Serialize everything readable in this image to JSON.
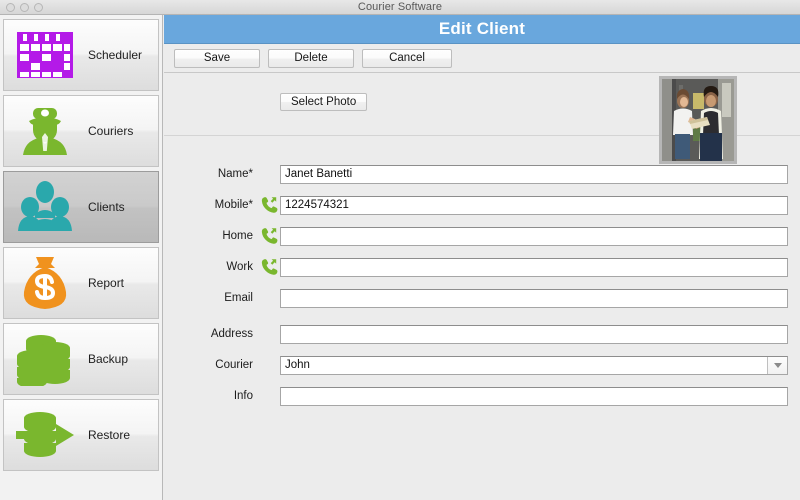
{
  "window": {
    "title": "Courier Software",
    "traffic_lights": [
      "close-button",
      "minimize-button",
      "zoom-button"
    ]
  },
  "sidebar": {
    "items": [
      {
        "label": "Scheduler",
        "icon": "calendar-icon",
        "color": "#b41ae8",
        "selected": false
      },
      {
        "label": "Couriers",
        "icon": "courier-person-icon",
        "color": "#7ab72e",
        "selected": false
      },
      {
        "label": "Clients",
        "icon": "clients-group-icon",
        "color": "#2aa8ac",
        "selected": true
      },
      {
        "label": "Report",
        "icon": "money-bag-icon",
        "color": "#f0921e",
        "selected": false
      },
      {
        "label": "Backup",
        "icon": "database-stack-icon",
        "color": "#7ab72e",
        "selected": false
      },
      {
        "label": "Restore",
        "icon": "database-restore-icon",
        "color": "#7ab72e",
        "selected": false
      }
    ]
  },
  "main": {
    "banner_title": "Edit Client",
    "banner_color": "#69a7dd",
    "toolbar": {
      "save_label": "Save",
      "delete_label": "Delete",
      "cancel_label": "Cancel"
    },
    "photo": {
      "select_photo_label": "Select Photo",
      "thumbnail_alt": "courier-handing-package-to-woman-at-door"
    },
    "form": {
      "fields": [
        {
          "label": "Name*",
          "value": "Janet Banetti",
          "placeholder": "",
          "icon": "",
          "type": "text"
        },
        {
          "label": "Mobile*",
          "value": "1224574321",
          "placeholder": "",
          "icon": "phone-call-icon",
          "type": "text"
        },
        {
          "label": "Home",
          "value": "",
          "placeholder": "",
          "icon": "phone-call-icon",
          "type": "text"
        },
        {
          "label": "Work",
          "value": "",
          "placeholder": "",
          "icon": "phone-call-icon",
          "type": "text"
        },
        {
          "label": "Email",
          "value": "",
          "placeholder": "",
          "icon": "",
          "type": "text"
        },
        {
          "label": "Address",
          "value": "",
          "placeholder": "",
          "icon": "",
          "type": "text"
        },
        {
          "label": "Courier",
          "value": "John",
          "placeholder": "",
          "icon": "",
          "type": "select"
        },
        {
          "label": "Info",
          "value": "",
          "placeholder": "",
          "icon": "",
          "type": "text"
        }
      ]
    }
  }
}
